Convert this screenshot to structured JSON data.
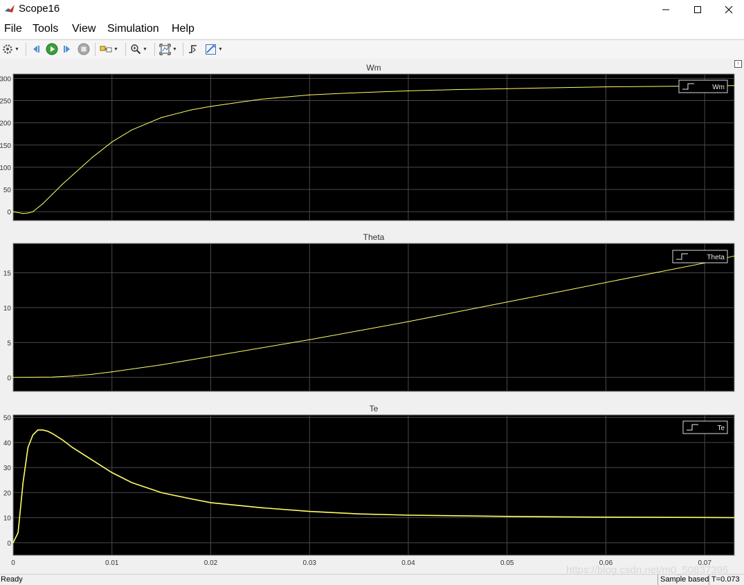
{
  "window": {
    "title": "Scope16"
  },
  "menu": [
    "File",
    "Tools",
    "View",
    "Simulation",
    "Help"
  ],
  "toolbar": {
    "buttons": [
      "settings-icon",
      "step-back-icon",
      "run-icon",
      "step-forward-icon",
      "stop-icon",
      "highlight-simulink-block-icon",
      "zoom-icon",
      "autoscale-icon",
      "triggers-icon",
      "cursor-measurements-icon"
    ]
  },
  "colors": {
    "plot_bg": "#000000",
    "trace": "#ffff66",
    "grid": "#4a4a4a",
    "axis_text": "#333333"
  },
  "chart_data": [
    {
      "type": "line",
      "title": "Wm",
      "legend": [
        "Wm"
      ],
      "legend_position": "top-right",
      "xlim": [
        0,
        0.073
      ],
      "ylim": [
        -20,
        310
      ],
      "x_ticks": [],
      "y_ticks": [
        "0",
        "50",
        "100",
        "150",
        "200",
        "250",
        "300"
      ],
      "grid": true,
      "series": [
        {
          "name": "Wm",
          "x": [
            0,
            0.0005,
            0.001,
            0.0015,
            0.002,
            0.003,
            0.004,
            0.005,
            0.006,
            0.008,
            0.01,
            0.012,
            0.015,
            0.018,
            0.02,
            0.025,
            0.03,
            0.035,
            0.04,
            0.045,
            0.05,
            0.055,
            0.06,
            0.065,
            0.07,
            0.073
          ],
          "y": [
            0,
            -2,
            -4,
            -3,
            0,
            18,
            40,
            62,
            82,
            122,
            157,
            184,
            212,
            229,
            237,
            253,
            263,
            268,
            272,
            275,
            277,
            279,
            281,
            282,
            283,
            284
          ]
        }
      ]
    },
    {
      "type": "line",
      "title": "Theta",
      "legend": [
        "Theta"
      ],
      "legend_position": "top-right",
      "xlim": [
        0,
        0.073
      ],
      "ylim": [
        -2,
        19.2
      ],
      "x_ticks": [],
      "y_ticks": [
        "0",
        "5",
        "10",
        "15"
      ],
      "grid": true,
      "series": [
        {
          "name": "Theta",
          "x": [
            0,
            0.004,
            0.006,
            0.008,
            0.01,
            0.015,
            0.02,
            0.025,
            0.03,
            0.035,
            0.04,
            0.045,
            0.05,
            0.055,
            0.06,
            0.065,
            0.07,
            0.073
          ],
          "y": [
            0,
            0.05,
            0.2,
            0.45,
            0.8,
            1.8,
            3.0,
            4.2,
            5.4,
            6.7,
            8.0,
            9.4,
            10.8,
            12.2,
            13.6,
            15.0,
            16.4,
            17.4
          ]
        }
      ]
    },
    {
      "type": "line",
      "title": "Te",
      "legend": [
        "Te"
      ],
      "legend_position": "top-right",
      "xlim": [
        0,
        0.073
      ],
      "ylim": [
        -5,
        51
      ],
      "x_ticks": [
        "0",
        "0.01",
        "0.02",
        "0.03",
        "0.04",
        "0.05",
        "0.06",
        "0.07"
      ],
      "y_ticks": [
        "0",
        "10",
        "20",
        "30",
        "40",
        "50"
      ],
      "grid": true,
      "series": [
        {
          "name": "Te",
          "x": [
            0,
            0.0005,
            0.001,
            0.0015,
            0.002,
            0.0025,
            0.003,
            0.0035,
            0.004,
            0.005,
            0.006,
            0.008,
            0.01,
            0.012,
            0.015,
            0.018,
            0.02,
            0.025,
            0.03,
            0.035,
            0.04,
            0.05,
            0.06,
            0.07,
            0.073
          ],
          "y": [
            0,
            4,
            24,
            38,
            43,
            45,
            45,
            44.5,
            43.5,
            41,
            38,
            33,
            28,
            24,
            20,
            17.5,
            16,
            14,
            12.5,
            11.5,
            11,
            10.5,
            10.2,
            10.1,
            10
          ]
        }
      ]
    }
  ],
  "status": {
    "left": "Ready",
    "mode": "Sample based",
    "time": "T=0.073"
  },
  "watermark": "https://blog.csdn.net/m0_50837395"
}
